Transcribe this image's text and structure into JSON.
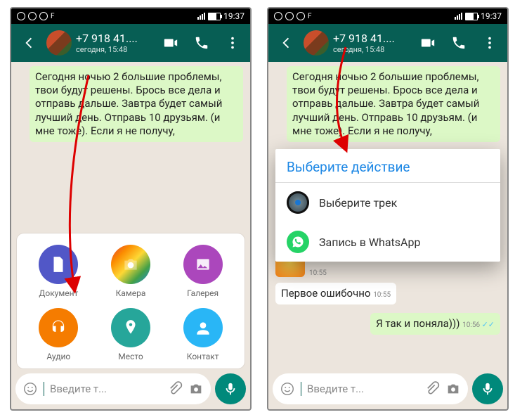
{
  "status": {
    "time": "19:37",
    "notif_label": "F"
  },
  "header": {
    "title": "+7 918 41....",
    "subtitle": "сегодня, 15:48"
  },
  "message_text": "Сегодня ночью 2 большие проблемы, твои будут решены. Брось все дела и отправь дальше. Завтра будет самый лучший день. Отправь 10 друзьям. (и мне тоже). Если я не получу,",
  "input": {
    "placeholder": "Введите т..."
  },
  "attach": {
    "document": "Документ",
    "camera": "Камера",
    "gallery": "Галерея",
    "audio": "Аудио",
    "location": "Место",
    "contact": "Контакт"
  },
  "right_extra": {
    "sticker_time": "10:55",
    "in_msg": "Первое ошибочно",
    "out_msg": "Я так и поняла)))",
    "in_time": "10:55",
    "out_time": "10:56"
  },
  "dialog": {
    "title": "Выберите действие",
    "option1": "Выберите трек",
    "option2": "Запись в WhatsApp"
  },
  "colors": {
    "doc": "#5157c7",
    "cam": "#e53935",
    "gal": "#ab47bc",
    "aud": "#f57c00",
    "loc": "#26a69a",
    "con": "#29b6f6"
  }
}
